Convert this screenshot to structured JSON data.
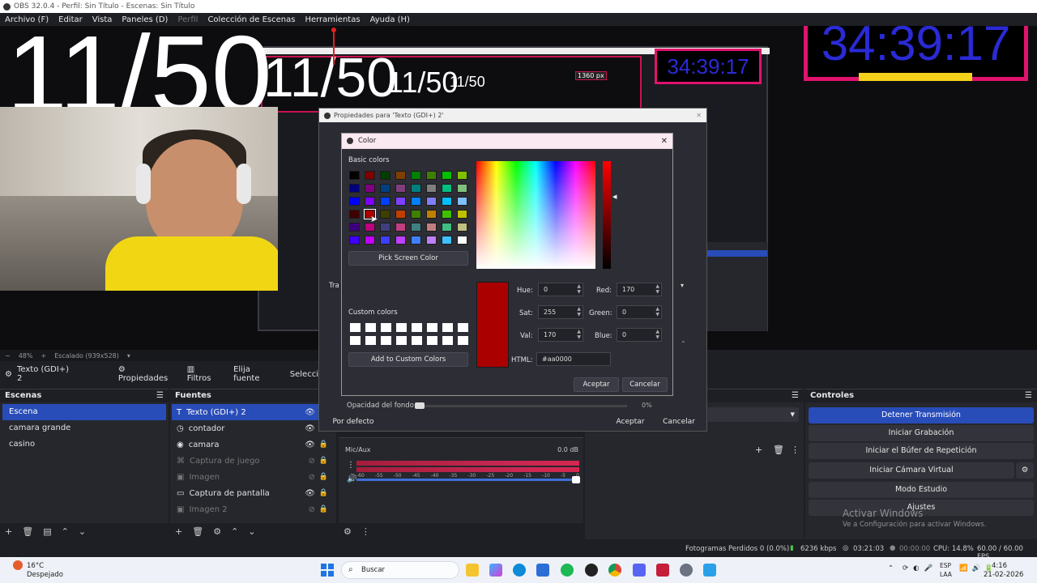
{
  "window": {
    "title": "OBS 32.0.4 - Perfil: Sin Título - Escenas: Sin Título"
  },
  "menu": [
    "Archivo (F)",
    "Editar",
    "Vista",
    "Paneles (D)",
    "Perfil",
    "Colección de Escenas",
    "Herramientas",
    "Ayuda (H)"
  ],
  "preview": {
    "counter": "11/50",
    "timer": "34:39:17",
    "resolution_tag": "1360 px",
    "zoom": "48%",
    "scale_label": "Escalado (939x528)"
  },
  "source_toolbar": {
    "selected": "Texto (GDI+) 2",
    "properties": "Propiedades",
    "filters": "Filtros",
    "choose_font": "Elija fuente",
    "select": "Selecci"
  },
  "properties_window": {
    "title": "Propiedades para 'Texto (GDI+) 2'",
    "defaults": "Por defecto",
    "ok": "Aceptar",
    "cancel": "Cancelar",
    "bg_opacity": "Opacidad del fondo",
    "bg_opacity_value": "0%",
    "partial_label": "Tra"
  },
  "color_dialog": {
    "title": "Color",
    "basic_colors_label": "Basic colors",
    "basic_colors": [
      [
        "#000000",
        "#7f0000",
        "#003f00",
        "#7f3f00",
        "#007f00",
        "#3f7f00",
        "#00bf00",
        "#7fbf00"
      ],
      [
        "#00007f",
        "#7f007f",
        "#003f7f",
        "#7f3f7f",
        "#007f7f",
        "#7f7f7f",
        "#00bf7f",
        "#7fbf7f"
      ],
      [
        "#0000ff",
        "#7f00ff",
        "#003fff",
        "#7f3fff",
        "#007fff",
        "#7f7fff",
        "#00bfff",
        "#7fbfff"
      ],
      [
        "#3f0000",
        "#aa0000",
        "#3f3f00",
        "#bf3f00",
        "#3f7f00",
        "#bf7f00",
        "#3fbf00",
        "#bfbf00"
      ],
      [
        "#3f007f",
        "#bf007f",
        "#3f3f7f",
        "#bf3f7f",
        "#3f7f7f",
        "#bf7f7f",
        "#3fbf7f",
        "#bfbf7f"
      ],
      [
        "#3f00ff",
        "#bf00ff",
        "#3f3fff",
        "#bf3fff",
        "#3f7fff",
        "#bf7fff",
        "#3fbfff",
        "#ffffff"
      ]
    ],
    "pick_screen": "Pick Screen Color",
    "custom_colors_label": "Custom colors",
    "add_custom": "Add to Custom Colors",
    "hue_label": "Hue:",
    "hue": "0",
    "sat_label": "Sat:",
    "sat": "255",
    "val_label": "Val:",
    "val": "170",
    "red_label": "Red:",
    "red": "170",
    "green_label": "Green:",
    "green": "0",
    "blue_label": "Blue:",
    "blue": "0",
    "html_label": "HTML:",
    "html": "#aa0000",
    "ok": "Aceptar",
    "cancel": "Cancelar",
    "current_color": "#aa0000"
  },
  "scenes": {
    "title": "Escenas",
    "items": [
      "Escena",
      "camara grande",
      "casino"
    ],
    "selected": 0
  },
  "sources": {
    "title": "Fuentes",
    "items": [
      {
        "name": "Texto (GDI+) 2",
        "icon": "text-icon",
        "visible": true,
        "selected": true
      },
      {
        "name": "contador",
        "icon": "clock-icon",
        "visible": true
      },
      {
        "name": "camara",
        "icon": "camera-icon",
        "visible": true
      },
      {
        "name": "Captura de juego",
        "icon": "gamepad-icon",
        "visible": false
      },
      {
        "name": "Imagen",
        "icon": "image-icon",
        "visible": false
      },
      {
        "name": "Captura de pantalla",
        "icon": "monitor-icon",
        "visible": true
      },
      {
        "name": "Imagen 2",
        "icon": "image-icon",
        "visible": false
      }
    ]
  },
  "mixer": {
    "channel": "Mic/Aux",
    "db": "0.0 dB",
    "ticks": [
      "-60",
      "-55",
      "-50",
      "-45",
      "-40",
      "-35",
      "-30",
      "-25",
      "-20",
      "-15",
      "-10",
      "-5",
      "0"
    ]
  },
  "controls": {
    "title": "Controles",
    "buttons": [
      "Detener Transmisión",
      "Iniciar Grabación",
      "Iniciar el Búfer de Repetición",
      "Iniciar Cámara Virtual",
      "Modo Estudio",
      "Ajustes"
    ]
  },
  "activation": {
    "title": "Activar Windows",
    "subtitle": "Ve a Configuración para activar Windows."
  },
  "status": {
    "dropped": "Fotogramas Perdidos 0 (0.0%)",
    "bitrate": "6236 kbps",
    "stream_time": "03:21:03",
    "rec_time": "00:00:00",
    "cpu": "CPU: 14.8%",
    "fps": "60.00 / 60.00 FPS"
  },
  "taskbar": {
    "weather_temp": "16°C",
    "weather_desc": "Despejado",
    "search": "Buscar",
    "lang1": "ESP",
    "lang2": "LAA",
    "time": "4:16",
    "date": "21-02-2026"
  }
}
